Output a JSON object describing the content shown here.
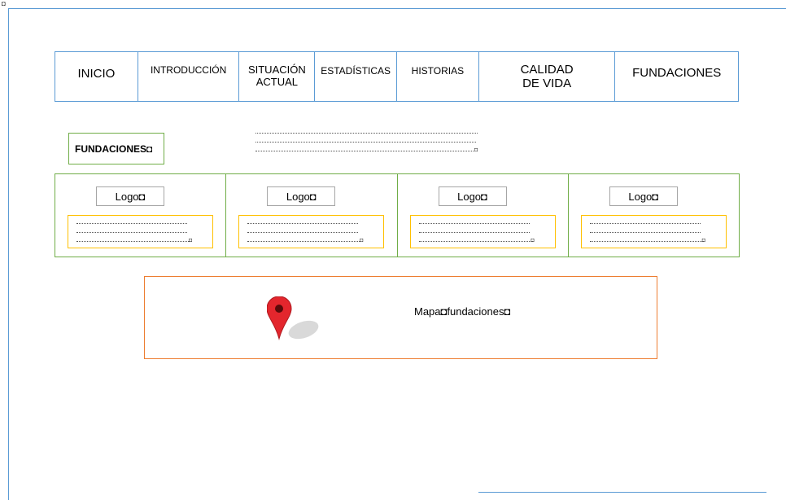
{
  "page": {
    "corner_glyph": "◘"
  },
  "nav": {
    "items": [
      {
        "label_lines": [
          "INICIO"
        ],
        "name": "nav-item-inicio"
      },
      {
        "label_lines": [
          "INTRODUCCIÓN"
        ],
        "name": "nav-item-introduccion"
      },
      {
        "label_lines": [
          "SITUACIÓN",
          "ACTUAL"
        ],
        "name": "nav-item-situacion-actual"
      },
      {
        "label_lines": [
          "ESTADÍSTICAS"
        ],
        "name": "nav-item-estadisticas"
      },
      {
        "label_lines": [
          "HISTORIAS"
        ],
        "name": "nav-item-historias"
      },
      {
        "label_lines": [
          "CALIDAD",
          "DE VIDA"
        ],
        "name": "nav-item-calidad-de-vida"
      },
      {
        "label_lines": [
          "FUNDACIONES"
        ],
        "name": "nav-item-fundaciones"
      }
    ]
  },
  "section": {
    "title": "FUNDACIONES◘",
    "placeholder_end_glyph": "◘"
  },
  "cards": [
    {
      "logo_label": "Logo◘",
      "desc_end_glyph": "◘"
    },
    {
      "logo_label": "Logo◘",
      "desc_end_glyph": "◘"
    },
    {
      "logo_label": "Logo◘",
      "desc_end_glyph": "◘"
    },
    {
      "logo_label": "Logo◘",
      "desc_end_glyph": "◘"
    }
  ],
  "map": {
    "label": "Mapa◘fundaciones◘",
    "icon": "map-pin-icon",
    "pin_color": "#e3262d"
  },
  "colors": {
    "nav_border": "#5b9bd5",
    "section_border": "#70ad47",
    "desc_border": "#ffc000",
    "map_border": "#ed7d31"
  }
}
